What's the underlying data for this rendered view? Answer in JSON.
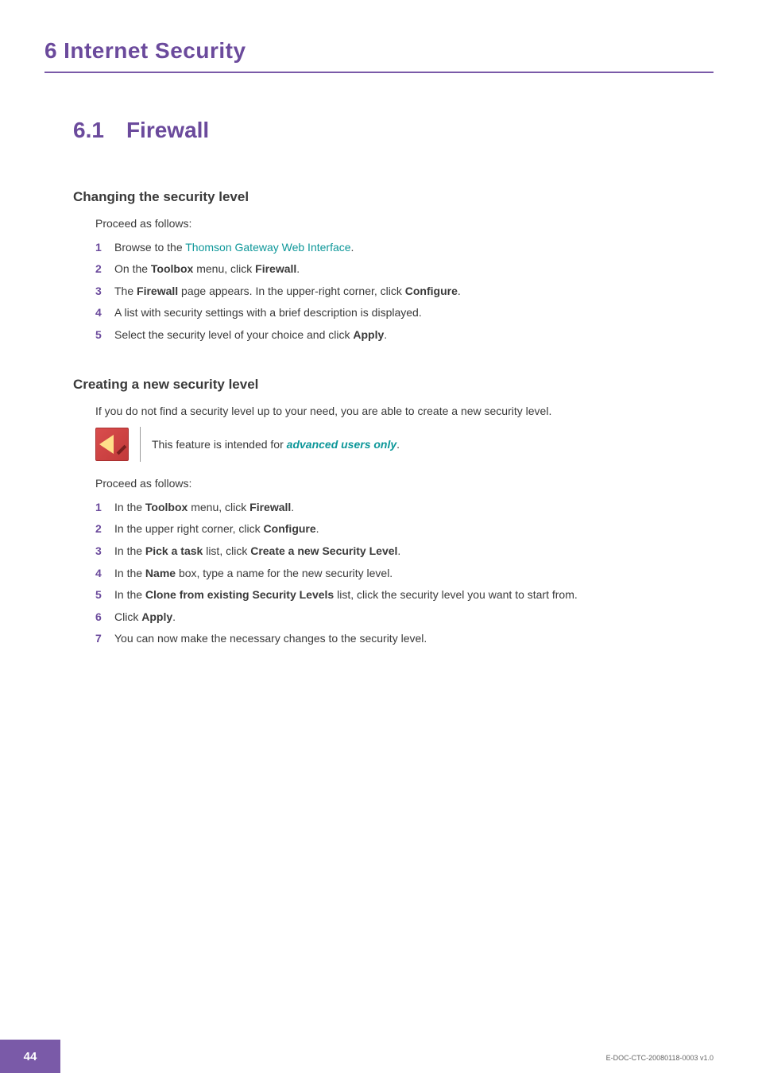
{
  "chapter": {
    "number": "6",
    "title": "Internet Security"
  },
  "section": {
    "number": "6.1",
    "title": "Firewall"
  },
  "sub1": {
    "title": "Changing the security level",
    "intro": "Proceed as follows:",
    "steps": {
      "n1": "1",
      "t1a": "Browse to the ",
      "t1b": "Thomson Gateway Web Interface",
      "t1c": ".",
      "n2": "2",
      "t2a": "On the ",
      "t2b": "Toolbox",
      "t2c": " menu, click ",
      "t2d": "Firewall",
      "t2e": ".",
      "n3": "3",
      "t3a": "The ",
      "t3b": "Firewall",
      "t3c": " page appears. In the upper-right corner, click ",
      "t3d": "Configure",
      "t3e": ".",
      "n4": "4",
      "t4": "A list with security settings with a brief description is displayed.",
      "n5": "5",
      "t5a": "Select the security level of your choice and click ",
      "t5b": "Apply",
      "t5c": "."
    }
  },
  "sub2": {
    "title": "Creating a new security level",
    "intro": "If you do not find a security level up to your need, you are able to create a new security level.",
    "callout": {
      "text_a": "This feature is intended for ",
      "text_b": "advanced users only",
      "text_c": "."
    },
    "proceed": "Proceed as follows:",
    "steps": {
      "n1": "1",
      "t1a": "In the ",
      "t1b": "Toolbox",
      "t1c": " menu, click ",
      "t1d": "Firewall",
      "t1e": ".",
      "n2": "2",
      "t2a": "In the upper right corner, click ",
      "t2b": "Configure",
      "t2c": ".",
      "n3": "3",
      "t3a": "In the ",
      "t3b": "Pick a task",
      "t3c": " list, click ",
      "t3d": "Create a new Security Level",
      "t3e": ".",
      "n4": "4",
      "t4a": "In the ",
      "t4b": "Name",
      "t4c": " box, type a name for the new security level.",
      "n5": "5",
      "t5a": "In the ",
      "t5b": "Clone from existing Security Levels",
      "t5c": " list, click the security level you want to start from.",
      "n6": "6",
      "t6a": "Click ",
      "t6b": "Apply",
      "t6c": ".",
      "n7": "7",
      "t7": "You can now make the necessary changes to the security level."
    }
  },
  "footer": {
    "page": "44",
    "docid": "E-DOC-CTC-20080118-0003 v1.0"
  }
}
